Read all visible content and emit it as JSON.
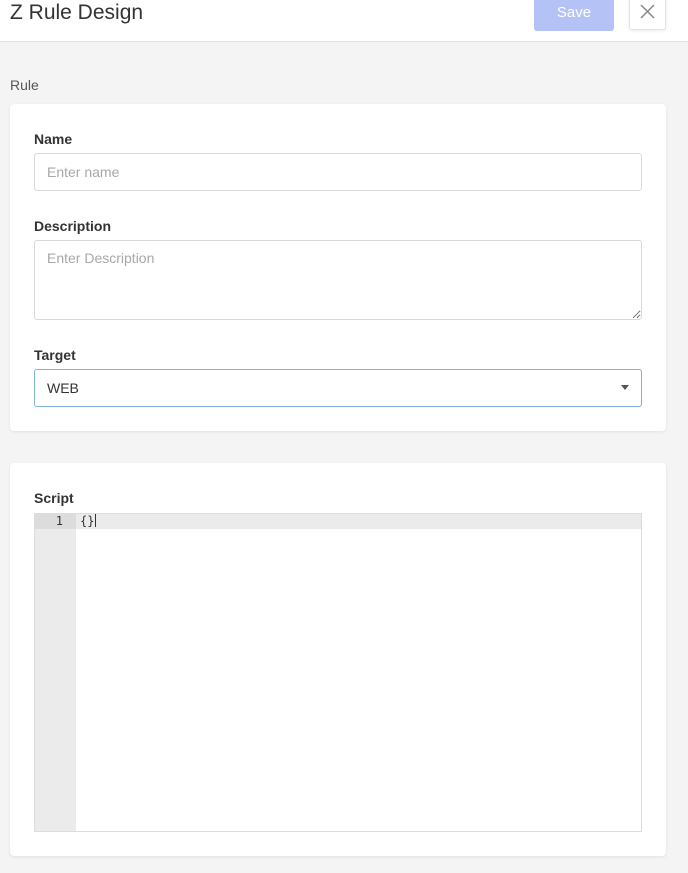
{
  "header": {
    "title": "Z Rule Design",
    "save_label": "Save",
    "close_icon": "close-icon"
  },
  "rule_section": {
    "label": "Rule",
    "name": {
      "label": "Name",
      "placeholder": "Enter name",
      "value": ""
    },
    "description": {
      "label": "Description",
      "placeholder": "Enter Description",
      "value": ""
    },
    "target": {
      "label": "Target",
      "value": "WEB"
    }
  },
  "script_section": {
    "label": "Script",
    "editor": {
      "lines": [
        {
          "number": "1",
          "text": "{}"
        }
      ]
    }
  },
  "colors": {
    "save_button_disabled": "#b5c2f5",
    "select_focus_border": "#7fb4d6",
    "page_background": "#f4f4f4"
  }
}
